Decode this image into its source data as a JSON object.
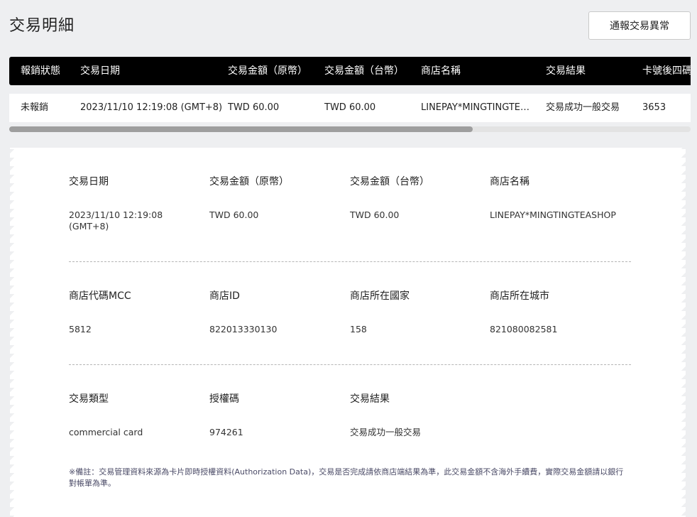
{
  "page": {
    "title": "交易明細",
    "report_button_label": "通報交易異常"
  },
  "table": {
    "headers": [
      "報銷狀態",
      "交易日期",
      "交易金額（原幣）",
      "交易金額（台幣）",
      "商店名稱",
      "交易結果",
      "卡號後四碼"
    ],
    "rows": [
      [
        "未報銷",
        "2023/11/10 12:19:08 (GMT+8)",
        "TWD 60.00",
        "TWD 60.00",
        "LINEPAY*MINGTINGTEASHOP",
        "交易成功一般交易",
        "3653"
      ]
    ],
    "scroll_fraction_visible": 0.68
  },
  "detail": {
    "sections": [
      {
        "fields": [
          {
            "label": "交易日期",
            "value": "2023/11/10 12:19:08 (GMT+8)"
          },
          {
            "label": "交易金額（原幣）",
            "value": "TWD 60.00"
          },
          {
            "label": "交易金額（台幣）",
            "value": "TWD 60.00"
          },
          {
            "label": "商店名稱",
            "value": "LINEPAY*MINGTINGTEASHOP"
          }
        ]
      },
      {
        "fields": [
          {
            "label": "商店代碼MCC",
            "value": "5812"
          },
          {
            "label": "商店ID",
            "value": "822013330130"
          },
          {
            "label": "商店所在國家",
            "value": "158"
          },
          {
            "label": "商店所在城市",
            "value": "821080082581"
          }
        ]
      },
      {
        "fields": [
          {
            "label": "交易類型",
            "value": "commercial card"
          },
          {
            "label": "授權碼",
            "value": "974261"
          },
          {
            "label": "交易結果",
            "value": "交易成功一般交易"
          }
        ]
      }
    ],
    "note": "※備註：交易管理資料來源為卡片即時授權資料(Authorization Data)，交易是否完成請依商店端結果為準，此交易金額不含海外手續費，實際交易金額請以銀行對帳單為準。"
  }
}
